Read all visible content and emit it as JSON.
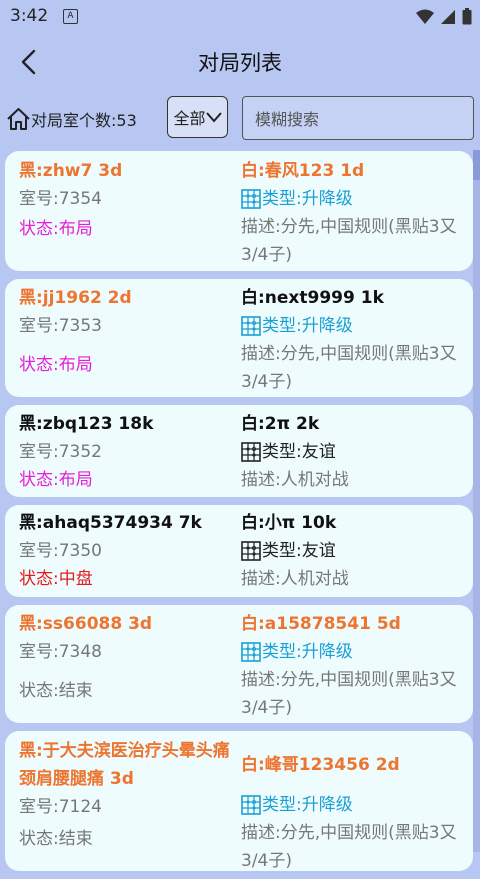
{
  "status": {
    "time": "3:42",
    "badge": "A"
  },
  "header": {
    "title": "对局列表"
  },
  "toolbar": {
    "count_label": "对局室个数:53",
    "filter_value": "全部",
    "search_placeholder": "模糊搜索"
  },
  "colors": {
    "background": "#b8c7f2",
    "card": "#eefcfd",
    "orange": "#ee7530",
    "cyan": "#1a9fd4",
    "magenta": "#e81fd6",
    "red": "#e51b1b"
  },
  "rooms": [
    {
      "black": "黑:zhw7 3d",
      "white": "白:春风123 1d",
      "room": "室号:7354",
      "type": "类型:升降级",
      "status": "状态:布局",
      "desc": "描述:分先,中国规则(黑贴3又3/4子)"
    },
    {
      "black": "黑:jj1962 2d",
      "white": "白:next9999 1k",
      "room": "室号:7353",
      "type": "类型:升降级",
      "status": "状态:布局",
      "desc": "描述:分先,中国规则(黑贴3又3/4子)"
    },
    {
      "black": "黑:zbq123 18k",
      "white": "白:2π 2k",
      "room": "室号:7352",
      "type": "类型:友谊",
      "status": "状态:布局",
      "desc": "描述:人机对战"
    },
    {
      "black": "黑:ahaq5374934 7k",
      "white": "白:小π 10k",
      "room": "室号:7350",
      "type": "类型:友谊",
      "status": "状态:中盘",
      "desc": "描述:人机对战"
    },
    {
      "black": "黑:ss66088 3d",
      "white": "白:a15878541 5d",
      "room": "室号:7348",
      "type": "类型:升降级",
      "status": "状态:结束",
      "desc": "描述:分先,中国规则(黑贴3又3/4子)"
    },
    {
      "black": "黑:于大夫滨医治疗头晕头痛颈肩腰腿痛 3d",
      "white": "白:峰哥123456 2d",
      "room": "室号:7124",
      "type": "类型:升降级",
      "status": "状态:结束",
      "desc": "描述:分先,中国规则(黑贴3又3/4子)"
    }
  ]
}
